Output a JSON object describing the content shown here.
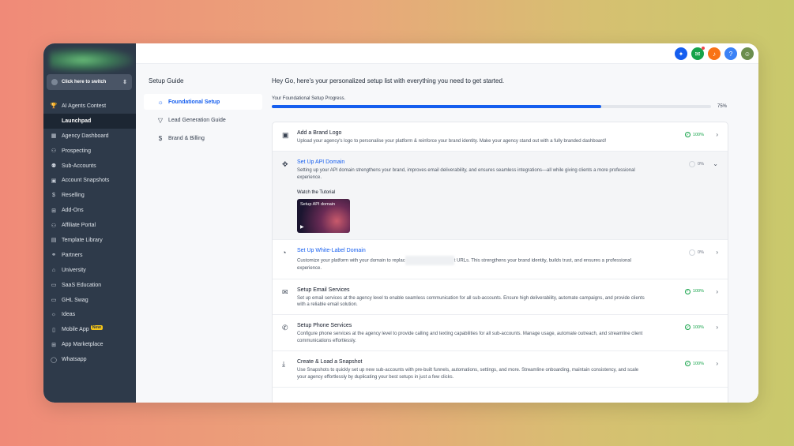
{
  "sidebar": {
    "switch_label": "Click here to switch",
    "items": [
      {
        "icon": "trophy-icon",
        "glyph": "🏆",
        "label": "AI Agents Contest"
      },
      {
        "icon": "rocket-icon",
        "glyph": "",
        "label": "Launchpad",
        "active": true
      },
      {
        "icon": "dashboard-icon",
        "glyph": "▦",
        "label": "Agency Dashboard"
      },
      {
        "icon": "prospecting-icon",
        "glyph": "⚇",
        "label": "Prospecting"
      },
      {
        "icon": "users-icon",
        "glyph": "⚉",
        "label": "Sub-Accounts"
      },
      {
        "icon": "snapshot-icon",
        "glyph": "▣",
        "label": "Account Snapshots"
      },
      {
        "icon": "reselling-icon",
        "glyph": "$",
        "label": "Reselling"
      },
      {
        "icon": "addons-icon",
        "glyph": "⊞",
        "label": "Add-Ons"
      },
      {
        "icon": "affiliate-icon",
        "glyph": "⚇",
        "label": "Affiliate Portal"
      },
      {
        "icon": "template-icon",
        "glyph": "▤",
        "label": "Template Library"
      },
      {
        "icon": "partners-icon",
        "glyph": "⚭",
        "label": "Partners"
      },
      {
        "icon": "university-icon",
        "glyph": "⌂",
        "label": "University"
      },
      {
        "icon": "education-icon",
        "glyph": "▭",
        "label": "SaaS Education"
      },
      {
        "icon": "swag-icon",
        "glyph": "▭",
        "label": "GHL Swag"
      },
      {
        "icon": "lightbulb-icon",
        "glyph": "☼",
        "label": "Ideas"
      },
      {
        "icon": "mobile-icon",
        "glyph": "▯",
        "label": "Mobile App",
        "badge": "New"
      },
      {
        "icon": "marketplace-icon",
        "glyph": "⊞",
        "label": "App Marketplace"
      },
      {
        "icon": "whatsapp-icon",
        "glyph": "◯",
        "label": "Whatsapp"
      }
    ]
  },
  "topbar": {
    "icons": [
      {
        "name": "magic-wand-icon",
        "glyph": "✦",
        "color": "#155eef"
      },
      {
        "name": "megaphone-icon",
        "glyph": "✉",
        "color": "#16a34a",
        "notify": true
      },
      {
        "name": "bell-icon",
        "glyph": "♪",
        "color": "#f97316"
      },
      {
        "name": "help-icon",
        "glyph": "?",
        "color": "#3b82f6"
      },
      {
        "name": "avatar-icon",
        "glyph": "☺",
        "color": "#6b8e4e"
      }
    ]
  },
  "guide": {
    "title": "Setup Guide",
    "items": [
      {
        "icon": "sun-icon",
        "glyph": "☼",
        "label": "Foundational Setup",
        "active": true
      },
      {
        "icon": "funnel-icon",
        "glyph": "▽",
        "label": "Lead Generation Guide"
      },
      {
        "icon": "dollar-icon",
        "glyph": "$",
        "label": "Brand & Billing"
      }
    ]
  },
  "main": {
    "greeting": "Hey Go, here's your personalized setup list with everything you need to get started.",
    "progress_label": "Your Foundational Setup Progress.",
    "progress_percent": 75,
    "progress_text": "75%",
    "tasks": [
      {
        "icon": "brand-logo-icon",
        "glyph": "▣",
        "title": "Add a Brand Logo",
        "desc": "Upload your agency's logo to personalise your platform & reinforce your brand identity. Make your agency stand out with a fully branded dashboard!",
        "status": "100%",
        "done": true,
        "link": false
      },
      {
        "icon": "api-domain-icon",
        "glyph": "✥",
        "title": "Set Up API Domain",
        "desc": "Setting up your API domain strengthens your brand, improves email deliverability, and ensures seamless integrations—all while giving clients a more professional experience.",
        "status": "0%",
        "done": false,
        "link": true,
        "expanded": true,
        "tutorial_label": "Watch the Tutorial",
        "tutorial_title": "Setup API domain"
      },
      {
        "icon": "white-label-icon",
        "glyph": "◔",
        "title": "Set Up White-Label Domain",
        "desc_before": "Customize your platform with your domain to replac",
        "desc_after": "t URLs. This strengthens your brand identity, builds trust, and ensures a professional experience.",
        "status": "0%",
        "done": false,
        "link": true
      },
      {
        "icon": "email-icon",
        "glyph": "✉",
        "title": "Setup Email Services",
        "desc": "Set up email services at the agency level to enable seamless communication for all sub-accounts. Ensure high deliverability, automate campaigns, and provide clients with a reliable email solution.",
        "status": "100%",
        "done": true,
        "link": false
      },
      {
        "icon": "phone-icon",
        "glyph": "✆",
        "title": "Setup Phone Services",
        "desc": "Configure phone services at the agency level to provide calling and texting capabilities for all sub-accounts. Manage usage, automate outreach, and streamline client communications effortlessly.",
        "status": "100%",
        "done": true,
        "link": false
      },
      {
        "icon": "download-icon",
        "glyph": "⤓",
        "title": "Create & Load a Snapshot",
        "desc": "Use Snapshots to quickly set up new sub-accounts with pre-built funnels, automations, settings, and more. Streamline onboarding, maintain consistency, and scale your agency effortlessly by duplicating your best setups in just a few clicks.",
        "status": "100%",
        "done": true,
        "link": false
      }
    ]
  }
}
